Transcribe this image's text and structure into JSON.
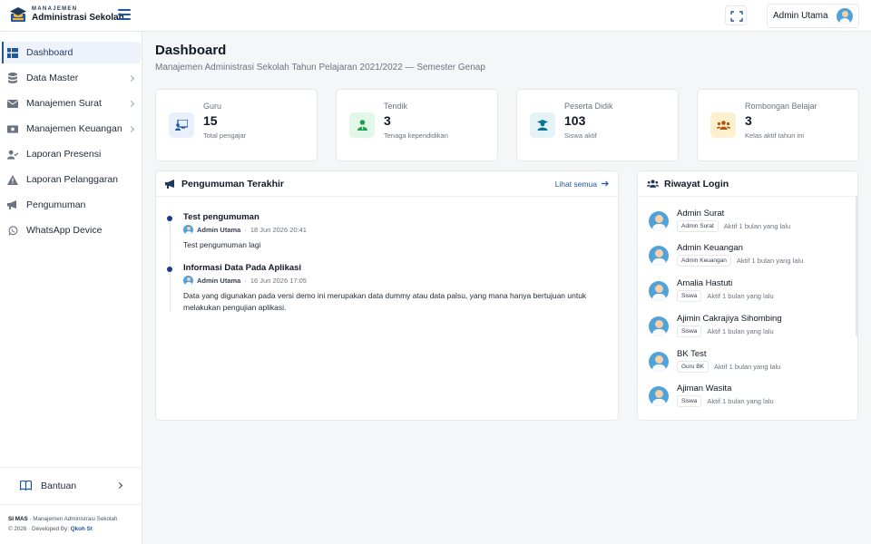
{
  "brand": {
    "line1": "MANAJEMEN",
    "line2": "Administrasi Sekolah"
  },
  "topbar": {
    "user_name": "Admin Utama"
  },
  "sidebar": {
    "items": [
      {
        "label": "Dashboard",
        "icon": "grid-icon",
        "active": true
      },
      {
        "label": "Data Master",
        "icon": "database-icon"
      },
      {
        "label": "Manajemen Surat",
        "icon": "envelope-icon"
      },
      {
        "label": "Manajemen Keuangan",
        "icon": "money-icon"
      },
      {
        "label": "Laporan Presensi",
        "icon": "user-check-icon"
      },
      {
        "label": "Laporan Pelanggaran",
        "icon": "warning-icon"
      },
      {
        "label": "Pengumuman",
        "icon": "megaphone-icon"
      },
      {
        "label": "WhatsApp Device",
        "icon": "whatsapp-icon"
      }
    ],
    "help_label": "Bantuan",
    "footer": {
      "app": "SI MAS",
      "app_desc": "· Manajemen Administrasi Sekolah",
      "copyright": "© 2026 · Developed By:",
      "developer": "Qkoh St"
    }
  },
  "page": {
    "title": "Dashboard",
    "subtitle": "Manajemen Administrasi Sekolah Tahun Pelajaran 2021/2022 — Semester Genap"
  },
  "stats": [
    {
      "label": "Guru",
      "value": "15",
      "desc": "Total pengajar",
      "icon": "chalkboard-icon",
      "color": "#1e56a0",
      "bg": "#e8f0fb"
    },
    {
      "label": "Tendik",
      "value": "3",
      "desc": "Tenaga kependidikan",
      "icon": "user-tie-icon",
      "color": "#16a34a",
      "bg": "#e3f6ea"
    },
    {
      "label": "Peserta Didik",
      "value": "103",
      "desc": "Siswa aktif",
      "icon": "graduate-icon",
      "color": "#0e7490",
      "bg": "#e3f3f8"
    },
    {
      "label": "Rombongan Belajar",
      "value": "3",
      "desc": "Kelas aktif tahun ini",
      "icon": "users-icon",
      "color": "#b45309",
      "bg": "#fdf0cf"
    }
  ],
  "announcements": {
    "title": "Pengumuman Terakhir",
    "see_all": "Lihat semua",
    "items": [
      {
        "title": "Test pengumuman",
        "author": "Admin Utama",
        "date": "18 Jun 2026 20:41",
        "body": "Test pengumuman lagi"
      },
      {
        "title": "Informasi Data Pada Aplikasi",
        "author": "Admin Utama",
        "date": "16 Jun 2026 17:05",
        "body": "Data yang digunakan pada versi demo ini merupakan data dummy atau data palsu, yang mana hanya bertujuan untuk melakukan pengujian aplikasi."
      }
    ]
  },
  "login_history": {
    "title": "Riwayat Login",
    "items": [
      {
        "name": "Admin Surat",
        "role": "Admin Surat",
        "time": "Aktif 1 bulan yang lalu"
      },
      {
        "name": "Admin Keuangan",
        "role": "Admin Keuangan",
        "time": "Aktif 1 bulan yang lalu"
      },
      {
        "name": "Amalia Hastuti",
        "role": "Siswa",
        "time": "Aktif 1 bulan yang lalu"
      },
      {
        "name": "Ajimin Cakrajiya Sihombing",
        "role": "Siswa",
        "time": "Aktif 1 bulan yang lalu"
      },
      {
        "name": "BK Test",
        "role": "Guru BK",
        "time": "Aktif 1 bulan yang lalu"
      },
      {
        "name": "Ajiman Wasita",
        "role": "Siswa",
        "time": "Aktif 1 bulan yang lalu"
      }
    ]
  },
  "colors": {
    "primary": "#1e56a0",
    "navy": "#1e3a5f",
    "border": "#e5e7eb"
  }
}
